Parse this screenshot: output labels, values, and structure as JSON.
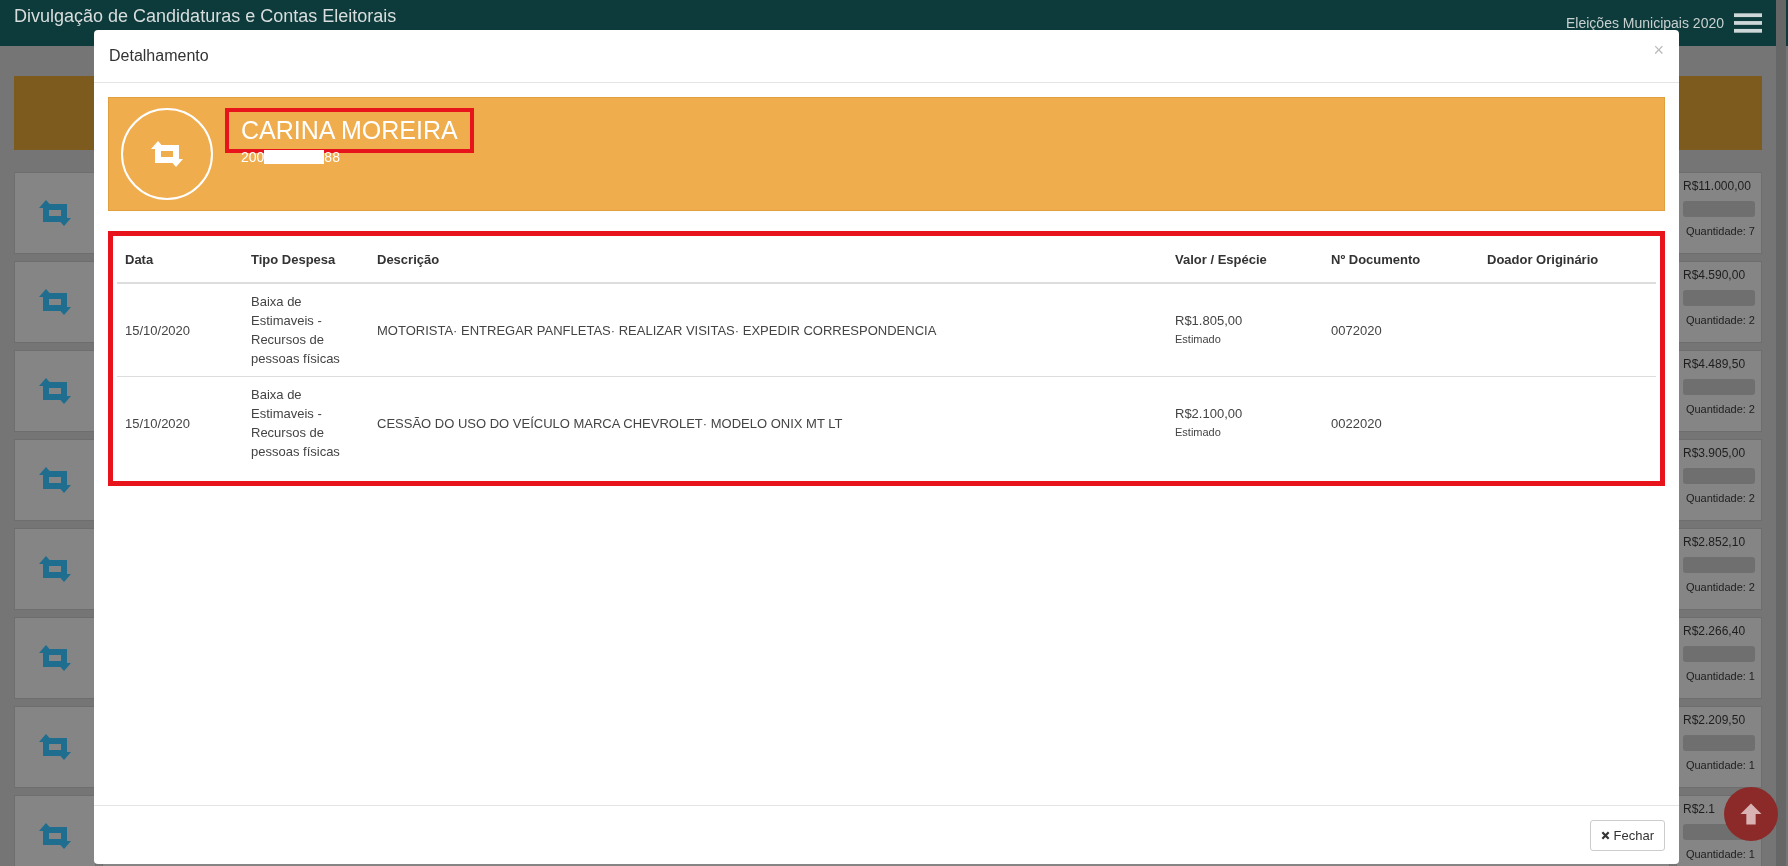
{
  "app_bar": {
    "title": "Divulgação de Candidaturas e Contas Eleitorais",
    "election": "Eleições Municipais 2020"
  },
  "background_list": [
    {
      "amount": "R$11.000,00",
      "level": 0,
      "quantity": "Quantidade: 7"
    },
    {
      "amount": "R$4.590,00",
      "level": 0,
      "quantity": "Quantidade: 2"
    },
    {
      "amount": "R$4.489,50",
      "level": 0,
      "quantity": "Quantidade: 2"
    },
    {
      "amount": "R$3.905,00",
      "level": 0,
      "quantity": "Quantidade: 2"
    },
    {
      "amount": "R$2.852,10",
      "level": 0,
      "quantity": "Quantidade: 2"
    },
    {
      "amount": "R$2.266,40",
      "level": 0,
      "quantity": "Quantidade: 1"
    },
    {
      "amount": "R$2.209,50",
      "level": 0,
      "quantity": "Quantidade: 1"
    },
    {
      "amount": "R$2.1",
      "level": 0,
      "quantity": "Quantidade: 1"
    }
  ],
  "modal": {
    "title": "Detalhamento",
    "close": "×",
    "candidate": {
      "name": "CARINA MOREIRA",
      "highlighted": true,
      "number_start": "200",
      "number_end": "88"
    },
    "table": {
      "highlighted": true,
      "columns": [
        "Data",
        "Tipo Despesa",
        "Descrição",
        "Valor / Espécie",
        "Nº Documento",
        "Doador Originário"
      ],
      "rows": [
        {
          "date": "15/10/2020",
          "type": "Baixa de Estimaveis - Recursos de pessoas físicas",
          "description": "MOTORISTA· ENTREGAR PANFLETAS· REALIZAR VISITAS· EXPEDIR CORRESPONDENCIA",
          "value": "R$1.805,00",
          "species": "Estimado",
          "document": "0072020"
        },
        {
          "date": "15/10/2020",
          "type": "Baixa de Estimaveis - Recursos de pessoas físicas",
          "description": "CESSÃO DO USO DO VEÍCULO MARCA CHEVROLET· MODELO ONIX MT LT",
          "value": "R$2.100,00",
          "species": "Estimado",
          "document": "0022020"
        }
      ]
    },
    "footer_button": "Fechar"
  }
}
